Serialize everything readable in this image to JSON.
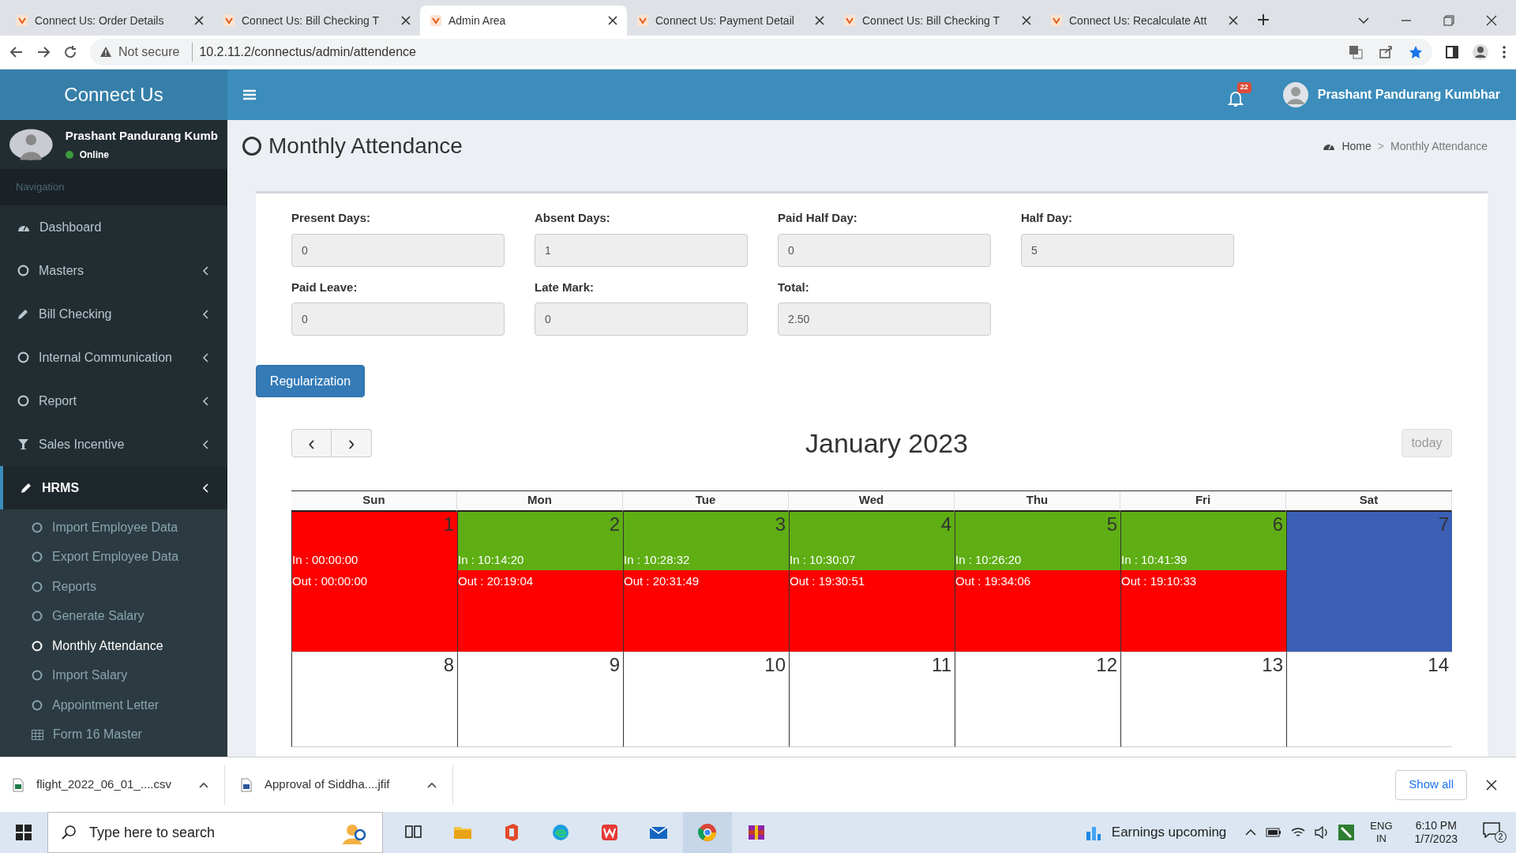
{
  "browser": {
    "tabs": [
      {
        "title": "Connect Us: Order Details",
        "selected": false
      },
      {
        "title": "Connect Us: Bill Checking T",
        "selected": false
      },
      {
        "title": "Admin Area",
        "selected": true
      },
      {
        "title": "Connect Us: Payment Detail",
        "selected": false
      },
      {
        "title": "Connect Us: Bill Checking T",
        "selected": false
      },
      {
        "title": "Connect Us: Recalculate Att",
        "selected": false
      }
    ],
    "security": "Not secure",
    "url": "10.2.11.2/connectus/admin/attendence"
  },
  "app": {
    "brand": "Connect Us",
    "user": "Prashant Pandurang Kumb",
    "status": "Online",
    "nav_heading": "Navigation",
    "nav": [
      {
        "label": "Dashboard",
        "kind": "dashboard",
        "selected": false,
        "expandable": false
      },
      {
        "label": "Masters",
        "kind": "circle",
        "selected": false,
        "expandable": true
      },
      {
        "label": "Bill Checking",
        "kind": "pencil",
        "selected": false,
        "expandable": true
      },
      {
        "label": "Internal Communication",
        "kind": "circle",
        "selected": false,
        "expandable": true
      },
      {
        "label": "Report",
        "kind": "circle",
        "selected": false,
        "expandable": true
      },
      {
        "label": "Sales Incentive",
        "kind": "filter",
        "selected": false,
        "expandable": true
      },
      {
        "label": "HRMS",
        "kind": "pencil",
        "selected": true,
        "expandable": true,
        "children": [
          {
            "label": "Import Employee Data",
            "kind": "circle",
            "selected": false
          },
          {
            "label": "Export Employee Data",
            "kind": "circle",
            "selected": false
          },
          {
            "label": "Reports",
            "kind": "circle",
            "selected": false
          },
          {
            "label": "Generate Salary",
            "kind": "circle",
            "selected": false
          },
          {
            "label": "Monthly Attendance",
            "kind": "circle",
            "selected": true
          },
          {
            "label": "Import Salary",
            "kind": "circle",
            "selected": false
          },
          {
            "label": "Appointment Letter",
            "kind": "circle",
            "selected": false
          },
          {
            "label": "Form 16 Master",
            "kind": "table",
            "selected": false
          }
        ]
      }
    ]
  },
  "header": {
    "notifications": "22",
    "user": "Prashant Pandurang Kumbhar"
  },
  "page": {
    "title": "Monthly Attendance",
    "breadcrumb": [
      "Home",
      "Monthly Attendance"
    ],
    "breadcrumb_separator": ">",
    "fields": [
      {
        "label": "Present Days:",
        "value": "0"
      },
      {
        "label": "Absent Days:",
        "value": "1"
      },
      {
        "label": "Paid Half Day:",
        "value": "0"
      },
      {
        "label": "Half Day:",
        "value": "5"
      },
      {
        "label": "Paid Leave:",
        "value": "0"
      },
      {
        "label": "Late Mark:",
        "value": "0"
      },
      {
        "label": "Total:",
        "value": "2.50"
      }
    ],
    "button": "Regularization",
    "calendar": {
      "prev": "‹",
      "next": "›",
      "title": "January 2023",
      "today": "today",
      "weekdays": [
        "Sun",
        "Mon",
        "Tue",
        "Wed",
        "Thu",
        "Fri",
        "Sat"
      ],
      "weeks": [
        [
          {
            "number": "1",
            "in": {
              "text": "In : 00:00:00",
              "color": "#ff0000"
            },
            "out": {
              "text": "Out : 00:00:00",
              "color": "#ff0000"
            }
          },
          {
            "number": "2",
            "in": {
              "text": "In : 10:14:20",
              "color": "#5fae14"
            },
            "out": {
              "text": "Out : 20:19:04",
              "color": "#ff0000"
            }
          },
          {
            "number": "3",
            "in": {
              "text": "In : 10:28:32",
              "color": "#5fae14"
            },
            "out": {
              "text": "Out : 20:31:49",
              "color": "#ff0000"
            }
          },
          {
            "number": "4",
            "in": {
              "text": "In : 10:30:07",
              "color": "#5fae14"
            },
            "out": {
              "text": "Out : 19:30:51",
              "color": "#ff0000"
            }
          },
          {
            "number": "5",
            "in": {
              "text": "In : 10:26:20",
              "color": "#5fae14"
            },
            "out": {
              "text": "Out : 19:34:06",
              "color": "#ff0000"
            }
          },
          {
            "number": "6",
            "in": {
              "text": "In : 10:41:39",
              "color": "#5fae14"
            },
            "out": {
              "text": "Out : 19:10:33",
              "color": "#ff0000"
            }
          },
          {
            "number": "7",
            "color": "#3a5fb5"
          }
        ],
        [
          {
            "number": "8"
          },
          {
            "number": "9"
          },
          {
            "number": "10"
          },
          {
            "number": "11"
          },
          {
            "number": "12"
          },
          {
            "number": "13"
          },
          {
            "number": "14"
          }
        ]
      ]
    }
  },
  "downloads": {
    "files": [
      {
        "name": "flight_2022_06_01_....csv",
        "kind": "sheet"
      },
      {
        "name": "Approval of Siddha....jfif",
        "kind": "doc"
      }
    ],
    "show_all": "Show all"
  },
  "taskbar": {
    "search": {
      "placeholder": "Type here to search"
    },
    "news": "Earnings upcoming",
    "lang": [
      "ENG",
      "IN"
    ],
    "time": "6:10 PM",
    "date": "1/7/2023",
    "notifications": "2"
  }
}
